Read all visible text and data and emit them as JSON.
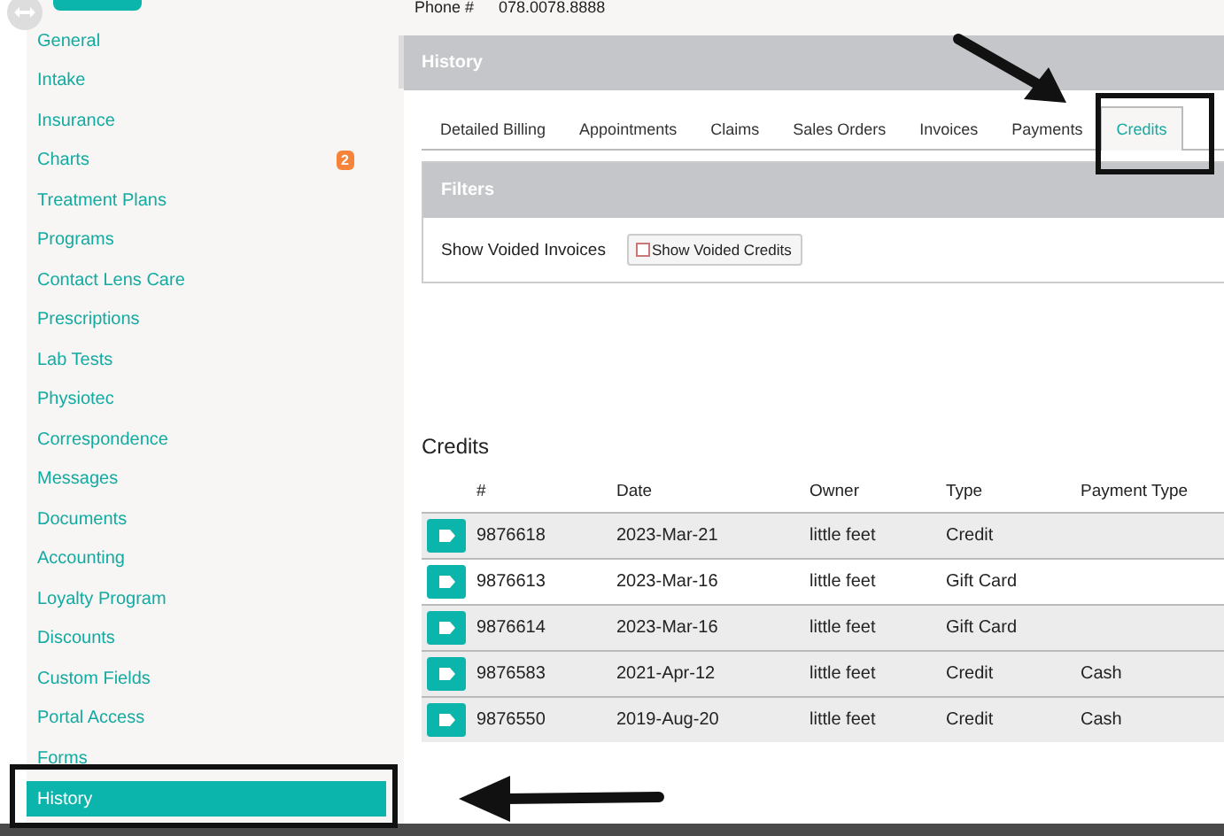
{
  "header": {
    "phone_label": "Phone #",
    "phone": "078.0078.8888"
  },
  "sidebar": {
    "items": [
      {
        "label": "General",
        "selected": false
      },
      {
        "label": "Intake",
        "selected": false
      },
      {
        "label": "Insurance",
        "selected": false
      },
      {
        "label": "Charts",
        "selected": false,
        "badge": "2"
      },
      {
        "label": "Treatment Plans",
        "selected": false
      },
      {
        "label": "Programs",
        "selected": false
      },
      {
        "label": "Contact Lens Care",
        "selected": false
      },
      {
        "label": "Prescriptions",
        "selected": false
      },
      {
        "label": "Lab Tests",
        "selected": false
      },
      {
        "label": "Physiotec",
        "selected": false
      },
      {
        "label": "Correspondence",
        "selected": false
      },
      {
        "label": "Messages",
        "selected": false
      },
      {
        "label": "Documents",
        "selected": false
      },
      {
        "label": "Accounting",
        "selected": false
      },
      {
        "label": "Loyalty Program",
        "selected": false
      },
      {
        "label": "Discounts",
        "selected": false
      },
      {
        "label": "Custom Fields",
        "selected": false
      },
      {
        "label": "Portal Access",
        "selected": false
      },
      {
        "label": "Forms",
        "selected": false
      },
      {
        "label": "History",
        "selected": true
      }
    ]
  },
  "history": {
    "title": "History",
    "tabs": [
      {
        "label": "Detailed Billing",
        "selected": false
      },
      {
        "label": "Appointments",
        "selected": false
      },
      {
        "label": "Claims",
        "selected": false
      },
      {
        "label": "Sales Orders",
        "selected": false
      },
      {
        "label": "Invoices",
        "selected": false
      },
      {
        "label": "Payments",
        "selected": false
      },
      {
        "label": "Credits",
        "selected": true
      }
    ],
    "filters": {
      "title": "Filters",
      "label": "Show Voided Invoices",
      "checkbox": {
        "label": "Show Voided Credits",
        "checked": false
      }
    }
  },
  "credits": {
    "title": "Credits",
    "columns": [
      "#",
      "Date",
      "Owner",
      "Type",
      "Payment Type"
    ],
    "rows": [
      {
        "cells": [
          "9876618",
          "2023-Mar-21",
          "little feet",
          "Credit",
          ""
        ]
      },
      {
        "cells": [
          "9876613",
          "2023-Mar-16",
          "little feet",
          "Gift Card",
          ""
        ]
      },
      {
        "cells": [
          "9876614",
          "2023-Mar-16",
          "little feet",
          "Gift Card",
          ""
        ]
      },
      {
        "cells": [
          "9876583",
          "2021-Apr-12",
          "little feet",
          "Credit",
          "Cash"
        ]
      },
      {
        "cells": [
          "9876550",
          "2019-Aug-20",
          "little feet",
          "Credit",
          "Cash"
        ]
      }
    ]
  }
}
